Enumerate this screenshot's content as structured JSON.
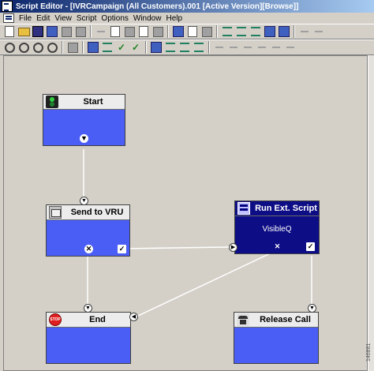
{
  "window": {
    "title": "Script Editor - [IVRCampaign (All Customers).001 [Active Version][Browse]]"
  },
  "menu": [
    "File",
    "Edit",
    "View",
    "Script",
    "Options",
    "Window",
    "Help"
  ],
  "nodes": {
    "start": {
      "label": "Start",
      "icon": "traffic-light-icon"
    },
    "send_to_vru": {
      "label": "Send to VRU",
      "icon": "vru-icon"
    },
    "run_ext_script": {
      "label": "Run Ext. Script",
      "sublabel": "VisibleQ",
      "icon": "script-icon"
    },
    "end": {
      "label": "End",
      "icon": "stop-sign-icon"
    },
    "release_call": {
      "label": "Release Call",
      "icon": "telephone-icon"
    }
  },
  "glyphs": {
    "success": "✓",
    "failure": "✕",
    "down": "▼",
    "right": "▶",
    "left": "◀"
  },
  "watermark": "146881",
  "colors": {
    "node_body": "#4a5ef6",
    "node_body_selected": "#0d0d85",
    "title_bar": "#0a246a"
  }
}
